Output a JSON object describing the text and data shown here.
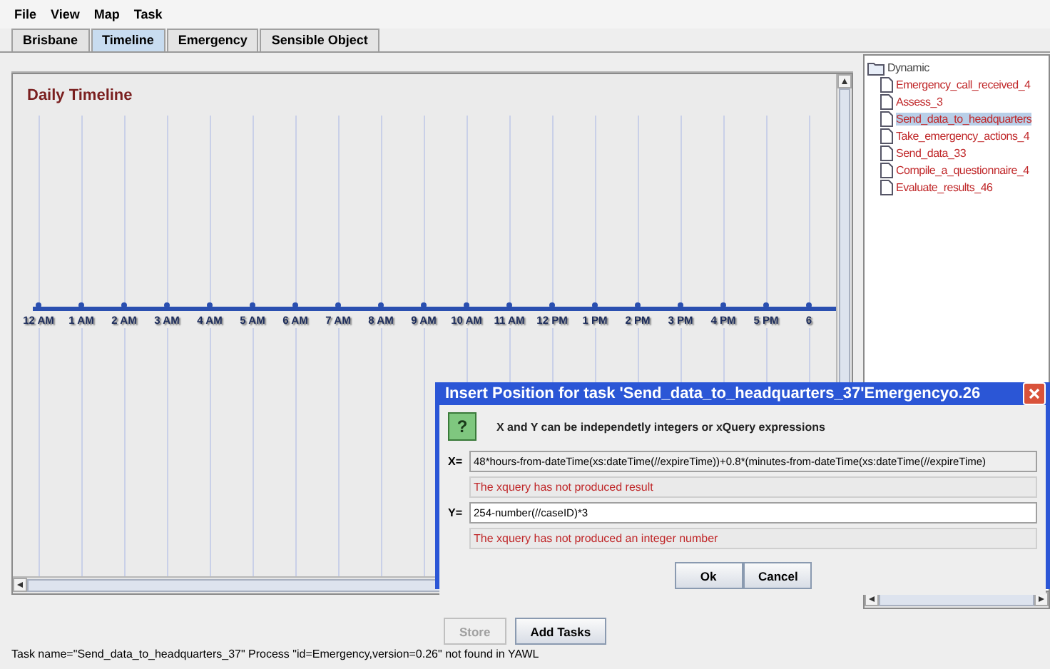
{
  "menu": [
    "File",
    "View",
    "Map",
    "Task"
  ],
  "tabs": [
    {
      "label": "Brisbane",
      "selected": false
    },
    {
      "label": "Timeline",
      "selected": true
    },
    {
      "label": "Emergency",
      "selected": false
    },
    {
      "label": "Sensible Object",
      "selected": false
    }
  ],
  "timeline": {
    "title": "Daily Timeline",
    "hours": [
      "12 AM",
      "1 AM",
      "2 AM",
      "3 AM",
      "4 AM",
      "5 AM",
      "6 AM",
      "7 AM",
      "8 AM",
      "9 AM",
      "10 AM",
      "11 AM",
      "12 PM",
      "1 PM",
      "2 PM",
      "3 PM",
      "4 PM",
      "5 PM",
      "6"
    ]
  },
  "tree": {
    "root": "Dynamic",
    "items": [
      {
        "label": "Emergency_call_received_4",
        "selected": false
      },
      {
        "label": "Assess_3",
        "selected": false
      },
      {
        "label": "Send_data_to_headquarters",
        "selected": true
      },
      {
        "label": "Take_emergency_actions_4",
        "selected": false
      },
      {
        "label": "Send_data_33",
        "selected": false
      },
      {
        "label": "Compile_a_questionnaire_4",
        "selected": false
      },
      {
        "label": "Evaluate_results_46",
        "selected": false
      }
    ]
  },
  "buttons": [
    {
      "label": "Store",
      "disabled": true
    },
    {
      "label": "Add Tasks",
      "disabled": false
    }
  ],
  "status": "Task name=\"Send_data_to_headquarters_37\" Process \"id=Emergency,version=0.26\" not found in YAWL",
  "dialog": {
    "title": "Insert Position for task 'Send_data_to_headquarters_37'Emergencyo.26",
    "icon_glyph": "?",
    "message": "X and Y can be independetly integers or xQuery expressions",
    "fields": [
      {
        "label": "X=",
        "value": "48*hours-from-dateTime(xs:dateTime(//expireTime))+0.8*(minutes-from-dateTime(xs:dateTime(//expireTime)",
        "error": "The xquery has not produced result"
      },
      {
        "label": "Y=",
        "value": "254-number(//caseID)*3",
        "error": "The xquery has not produced an integer number"
      }
    ],
    "buttons": [
      "Ok",
      "Cancel"
    ]
  }
}
